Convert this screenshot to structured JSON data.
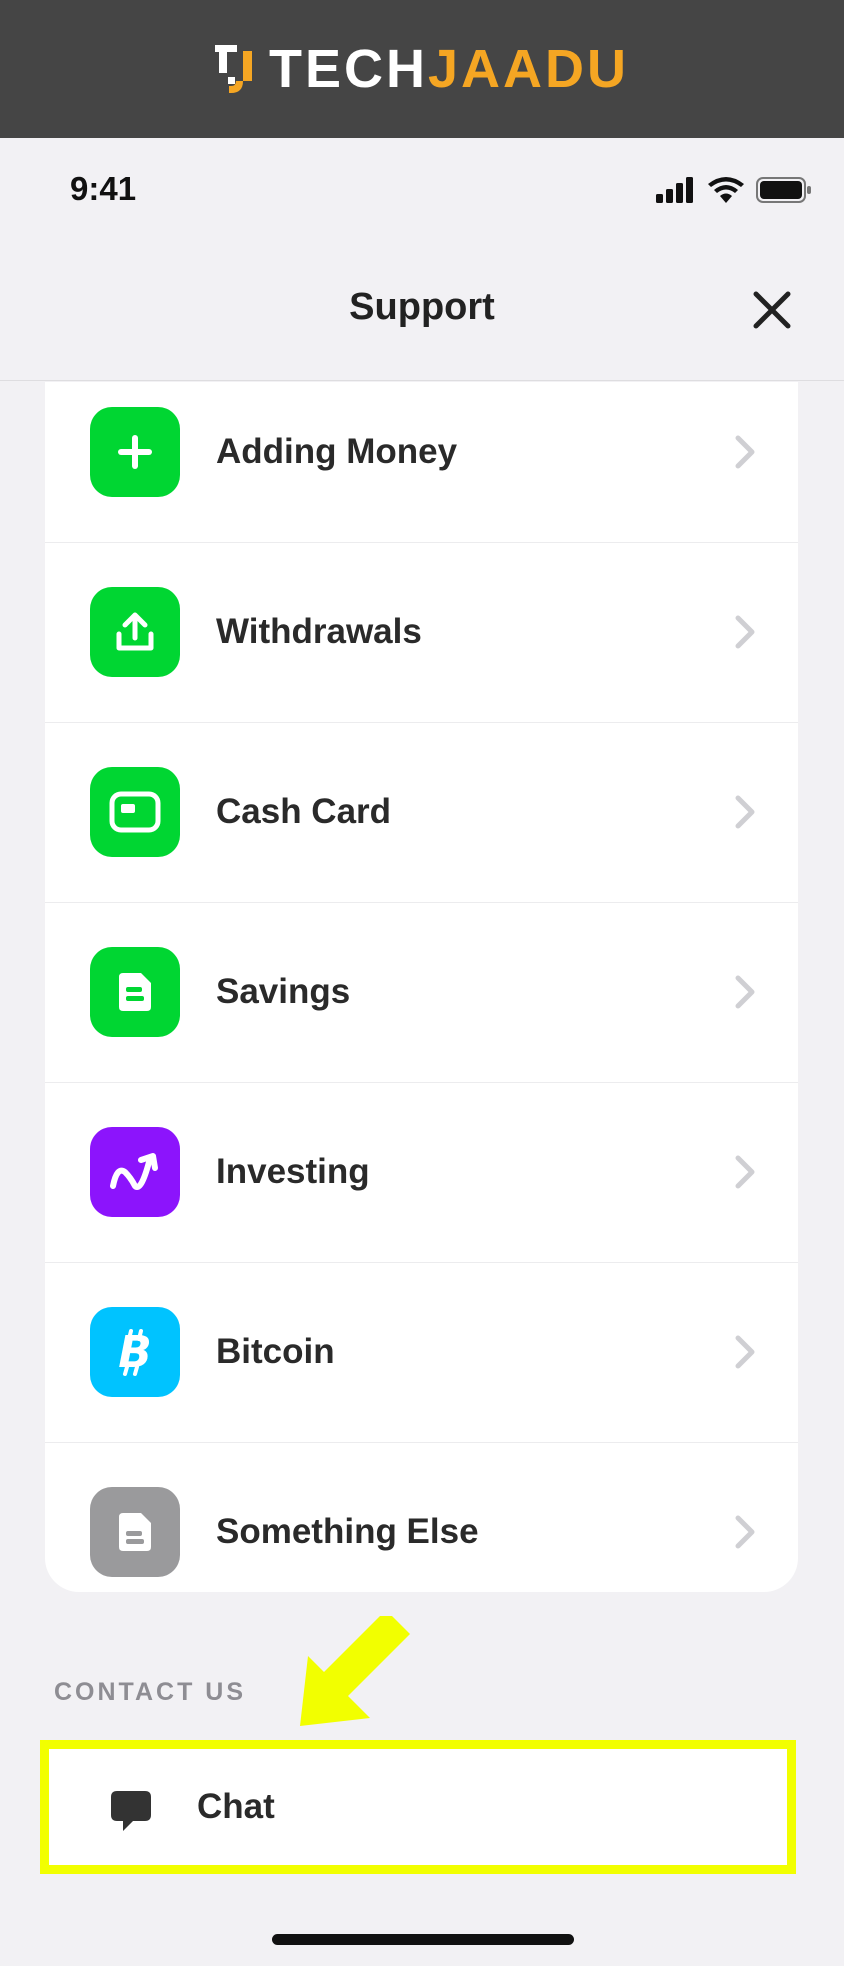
{
  "banner": {
    "logo_white": "TECH",
    "logo_orange": "JAADU"
  },
  "status": {
    "time": "9:41"
  },
  "header": {
    "title": "Support"
  },
  "topics": [
    {
      "label": "Adding Money",
      "icon": "plus-icon",
      "color": "#00d632"
    },
    {
      "label": "Withdrawals",
      "icon": "upload-icon",
      "color": "#00d632"
    },
    {
      "label": "Cash Card",
      "icon": "card-icon",
      "color": "#00d632"
    },
    {
      "label": "Savings",
      "icon": "savings-icon",
      "color": "#00d632"
    },
    {
      "label": "Investing",
      "icon": "trend-icon",
      "color": "#8c14fc"
    },
    {
      "label": "Bitcoin",
      "icon": "bitcoin-icon",
      "color": "#00c3ff"
    },
    {
      "label": "Something Else",
      "icon": "document-icon",
      "color": "#9a9a9c"
    }
  ],
  "contact": {
    "heading": "CONTACT US",
    "chat_label": "Chat"
  },
  "colors": {
    "highlight": "#f2ff00",
    "accent": "#f5a623"
  }
}
